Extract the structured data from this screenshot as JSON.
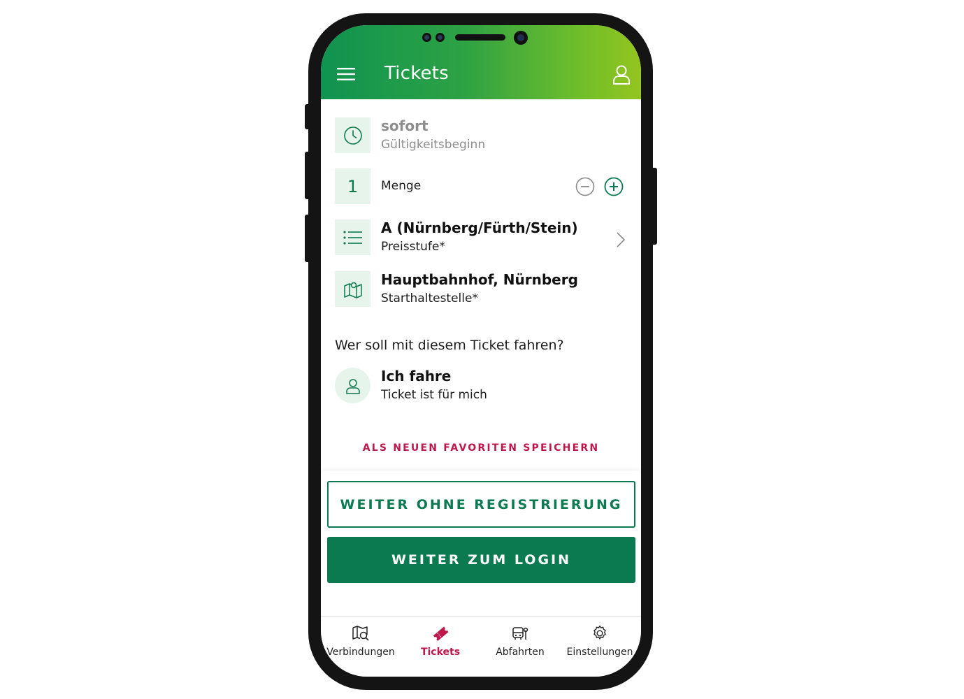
{
  "header": {
    "title": "Tickets",
    "menu_icon": "hamburger-menu-icon",
    "profile_icon": "user-profile-icon"
  },
  "rows": {
    "validity": {
      "title": "sofort",
      "subtitle": "Gültigkeitsbeginn",
      "icon": "clock-icon"
    },
    "quantity": {
      "value": "1",
      "label": "Menge",
      "minus_icon": "minus-circle-icon",
      "plus_icon": "plus-circle-icon"
    },
    "price_level": {
      "title": "A (Nürnberg/Fürth/Stein)",
      "subtitle": "Preisstufe*",
      "icon": "list-icon",
      "chevron": "chevron-right-icon"
    },
    "start_stop": {
      "title": "Hauptbahnhof, Nürnberg",
      "subtitle": "Starthaltestelle*",
      "icon": "map-icon"
    }
  },
  "passenger": {
    "question": "Wer soll mit diesem Ticket fahren?",
    "title": "Ich fahre",
    "subtitle": "Ticket ist für mich",
    "icon": "person-icon"
  },
  "actions": {
    "favorite_link": "ALS NEUEN FAVORITEN SPEICHERN",
    "continue_without_registration": "WEITER OHNE REGISTRIERUNG",
    "continue_to_login": "WEITER ZUM LOGIN"
  },
  "tabbar": {
    "items": [
      {
        "label": "Verbindungen",
        "icon": "map-search-icon",
        "active": false
      },
      {
        "label": "Tickets",
        "icon": "ticket-icon",
        "active": true
      },
      {
        "label": "Abfahrten",
        "icon": "bus-stop-icon",
        "active": false
      },
      {
        "label": "Einstellungen",
        "icon": "gear-icon",
        "active": false
      }
    ]
  },
  "colors": {
    "primary_green": "#0b7a50",
    "header_gradient_start": "#0f9350",
    "header_gradient_end": "#94c51f",
    "accent_red": "#c0174a",
    "icon_bg": "#e6f4ec"
  }
}
